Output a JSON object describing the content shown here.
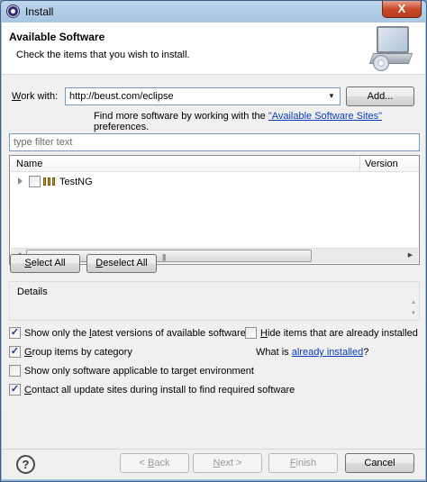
{
  "window": {
    "title": "Install",
    "close_label": "X"
  },
  "header": {
    "title": "Available Software",
    "subtitle": "Check the items that you wish to install.",
    "icon": "monitor-install-icon"
  },
  "work_with": {
    "label_w": "W",
    "label_rest": "ork with:",
    "value": "http://beust.com/eclipse",
    "add_button": "Add...",
    "hint_prefix": "Find more software by working with the ",
    "hint_link": "\"Available Software Sites\"",
    "hint_suffix": " preferences."
  },
  "filter": {
    "placeholder": "type filter text"
  },
  "tree": {
    "columns": [
      "Name",
      "Version"
    ],
    "rows": [
      {
        "label": "TestNG",
        "version": "",
        "checked": false,
        "expandable": true
      }
    ]
  },
  "selection_buttons": {
    "select_all_u": "S",
    "select_all_rest": "elect All",
    "deselect_all_u": "D",
    "deselect_all_rest": "eselect All"
  },
  "details": {
    "label": "Details"
  },
  "options": {
    "show_latest_a": "Show only the ",
    "show_latest_u": "l",
    "show_latest_b": "atest versions of available software",
    "show_latest_checked": true,
    "hide_installed_u": "H",
    "hide_installed_rest": "ide items that are already installed",
    "hide_installed_checked": false,
    "group_u": "G",
    "group_rest": "roup items by category",
    "group_checked": true,
    "what_is": "What is ",
    "already_installed_link": "already installed",
    "what_is_suffix": "?",
    "applicable": "Show only software applicable to target environment",
    "applicable_checked": false,
    "contact_u": "C",
    "contact_rest": "ontact all update sites during install to find required software",
    "contact_checked": true
  },
  "footer": {
    "help": "?",
    "back": "< Back",
    "back_u": "B",
    "next": "Next >",
    "next_u": "N",
    "finish": "Finish",
    "finish_u": "F",
    "cancel": "Cancel"
  },
  "icons": {
    "app": "eclipse-icon",
    "combo": "chevron-down-icon",
    "check": "✓"
  }
}
